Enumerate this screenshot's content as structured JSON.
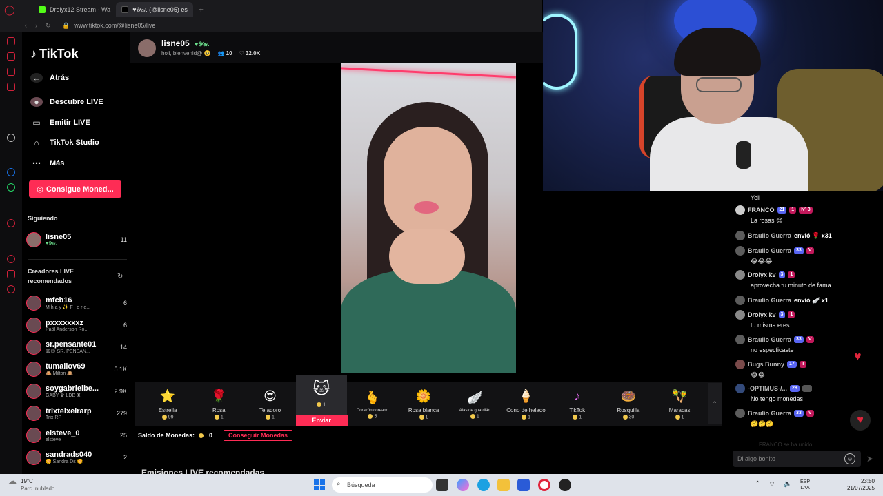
{
  "browser": {
    "tabs": [
      {
        "title": "Drolyx12 Stream - Wa"
      },
      {
        "title": "♥𝒴𝑒𝒾. (@lisne05) es"
      }
    ],
    "new_tab": "+",
    "url": "www.tiktok.com/@lisne05/live"
  },
  "tiktok": {
    "logo": "TikTok",
    "back": "Atrás",
    "nav": [
      {
        "label": "Descubre LIVE",
        "icon": "live-discover-icon"
      },
      {
        "label": "Emitir LIVE",
        "icon": "camera-icon"
      },
      {
        "label": "TikTok Studio",
        "icon": "home-icon"
      },
      {
        "label": "Más",
        "icon": "more-icon"
      }
    ],
    "coins_button": "Consigue Moned...",
    "following_label": "Siguiendo",
    "following": [
      {
        "name": "lisne05",
        "sub": "♥𝒴𝑒𝒾.",
        "count": "11"
      }
    ],
    "recommended_label": "Creadores LIVE recomendados",
    "creators": [
      {
        "name": "mfcb16",
        "sub": "M h a y ✨ F l o r e...",
        "count": "6"
      },
      {
        "name": "pxxxxxxxz",
        "sub": "Paöl Anderson Ro...",
        "count": "6"
      },
      {
        "name": "sr.pensante01",
        "sub": "😩😩 SR. PENSAN...",
        "count": "14"
      },
      {
        "name": "tumailov69",
        "sub": "🙈 Milton 🙈",
        "count": "5.1K"
      },
      {
        "name": "soygabrielbe...",
        "sub": "GABY ♛ LDB ♜",
        "count": "2.9K"
      },
      {
        "name": "trixteixeirarp",
        "sub": "Trix RP",
        "count": "279"
      },
      {
        "name": "elsteve_0",
        "sub": "elsteve",
        "count": "25"
      },
      {
        "name": "sandrads040",
        "sub": "🌼 Sandra Ds 🌼",
        "count": "2"
      }
    ]
  },
  "live": {
    "host_name": "lisne05",
    "host_tag": "♥𝒴𝑒𝒾.",
    "host_subtitle": "holi, bienvenid@ 🥹",
    "viewers": "10",
    "likes": "32.0K",
    "gifts": [
      {
        "name": "Estrella",
        "cost": "99",
        "icon": "⭐"
      },
      {
        "name": "Rosa",
        "cost": "1",
        "icon": "🌹"
      },
      {
        "name": "Te adoro",
        "cost": "1",
        "icon": "😍"
      },
      {
        "name": "",
        "cost": "1",
        "icon": "🐱",
        "selected": true
      },
      {
        "name": "Corazón coreano",
        "cost": "5",
        "icon": "🫰"
      },
      {
        "name": "Rosa blanca",
        "cost": "1",
        "icon": "🌼"
      },
      {
        "name": "Alas de guardián",
        "cost": "1",
        "icon": "🪽"
      },
      {
        "name": "Cono de helado",
        "cost": "1",
        "icon": "🍦"
      },
      {
        "name": "TikTok",
        "cost": "1",
        "icon": "♪"
      },
      {
        "name": "Rosquilla",
        "cost": "30",
        "icon": "🍩"
      },
      {
        "name": "Maracas",
        "cost": "1",
        "icon": "🪇"
      }
    ],
    "send_label": "Enviar",
    "balance_label": "Saldo de Monedas:",
    "balance_value": "0",
    "buy_coins": "Conseguir Monedas",
    "recommended_streams": "Emisiones LIVE recomendadas"
  },
  "chat": {
    "top_text": "Yeii",
    "messages": [
      {
        "user": "FRANCO",
        "badges": [
          "21",
          "1",
          "Nº 3"
        ],
        "text": "La rosas 😊"
      },
      {
        "user": "Braulio Guerra",
        "action": "envió 🌹 x31"
      },
      {
        "user": "Braulio Guerra",
        "badges": [
          "33",
          "V"
        ],
        "text": "😂😂😂"
      },
      {
        "user": "Drolyx kv",
        "badges": [
          "3",
          "1"
        ],
        "text": "aprovecha tu minuto de fama"
      },
      {
        "user": "Braulio Guerra",
        "action": "envió 🪽 x1"
      },
      {
        "user": "Drolyx kv",
        "badges": [
          "3",
          "1"
        ],
        "text": "tu misma eres"
      },
      {
        "user": "Braulio Guerra",
        "badges": [
          "33",
          "V"
        ],
        "text": "no especficaste"
      },
      {
        "user": "Bugs Bunny",
        "badges": [
          "17",
          "II"
        ],
        "text": "😂😂"
      },
      {
        "user": "-OPTIMUS-/...",
        "badges": [
          "28"
        ],
        "text": "No tengo monedas"
      },
      {
        "user": "Braulio Guerra",
        "badges": [
          "33",
          "V"
        ],
        "text": "🤔🤔🤔"
      }
    ],
    "joined_text": "FRANCO se ha unido",
    "input_placeholder": "Di algo bonito"
  },
  "taskbar": {
    "temp": "19°C",
    "weather": "Parc. nublado",
    "search": "Búsqueda",
    "lang_top": "ESP",
    "lang_bottom": "LAA",
    "time": "23:50",
    "date": "21/07/2025"
  },
  "colors": {
    "accent": "#fe2c55",
    "opera": "#e0243b",
    "coin": "#f2c94c"
  }
}
